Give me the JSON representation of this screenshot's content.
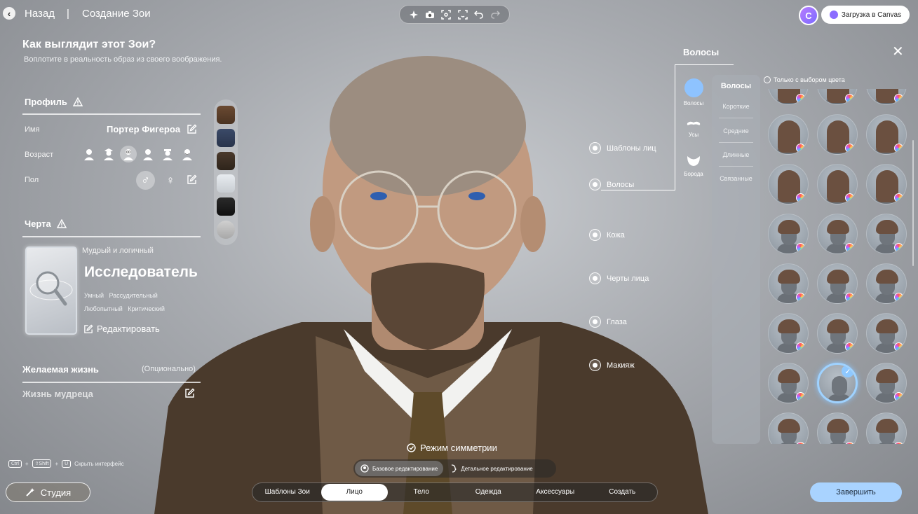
{
  "topbar": {
    "back_label": "Назад",
    "separator": "|",
    "title": "Создание Зои",
    "canvas_button": "Загрузка в Canvas",
    "avatar_letter": "C",
    "tools": [
      "sparkle-icon",
      "camera-icon",
      "focus-icon",
      "face-scan-icon",
      "undo-icon",
      "redo-icon"
    ]
  },
  "left": {
    "title": "Как выглядит этот Зои?",
    "subtitle": "Воплотите в реальность образ из своего воображения.",
    "profile": {
      "heading": "Профиль",
      "name_label": "Имя",
      "name_value": "Портер Фигероа",
      "age_label": "Возраст",
      "age_options": [
        "toddler",
        "teen",
        "young-adult",
        "adult",
        "middle-aged",
        "elder"
      ],
      "age_selected": 2,
      "gender_label": "Пол",
      "gender_male": "♂",
      "gender_female": "♀"
    },
    "trait": {
      "heading": "Черта",
      "tagline": "Мудрый и логичный",
      "name": "Исследователь",
      "keywords_1": "Умный   Рассудительный",
      "keywords_2": "Любопытный   Критический",
      "edit_label": "Редактировать"
    },
    "life": {
      "heading": "Желаемая жизнь",
      "optional": "(Опционально)",
      "value": "Жизнь мудреца"
    },
    "hotkey": {
      "k1": "Ctrl",
      "plus": "+",
      "k2": "⇧Shift",
      "k3": "U",
      "label": "Скрыть интерфейс"
    },
    "studio_button": "Студия"
  },
  "hotspots": {
    "face_templates": "Шаблоны лиц",
    "hair": "Волосы",
    "skin": "Кожа",
    "features": "Черты лица",
    "eyes": "Глаза",
    "makeup": "Макияж"
  },
  "hair_panel": {
    "title": "Волосы",
    "categories": {
      "hair": "Волосы",
      "mustache": "Усы",
      "beard": "Борода"
    },
    "subcategories": {
      "all": "Волосы",
      "short": "Короткие",
      "medium": "Средние",
      "long": "Длинные",
      "tied": "Связанные"
    },
    "color_filter": "Только с выбором цвета",
    "selected_index": 19,
    "tile_count": 27
  },
  "bottom": {
    "symmetry": "Режим симметрии",
    "mode_basic": "Базовое редактирование",
    "mode_detailed": "Детальное редактирование",
    "tabs": [
      "Шаблоны Зои",
      "Лицо",
      "Тело",
      "Одежда",
      "Аксессуары",
      "Создать"
    ],
    "active_tab": 1,
    "finish": "Завершить"
  },
  "colors": {
    "accent": "#a9d3ff",
    "selection": "#9fd2ff",
    "canvas_brand": "#8b6cff"
  }
}
